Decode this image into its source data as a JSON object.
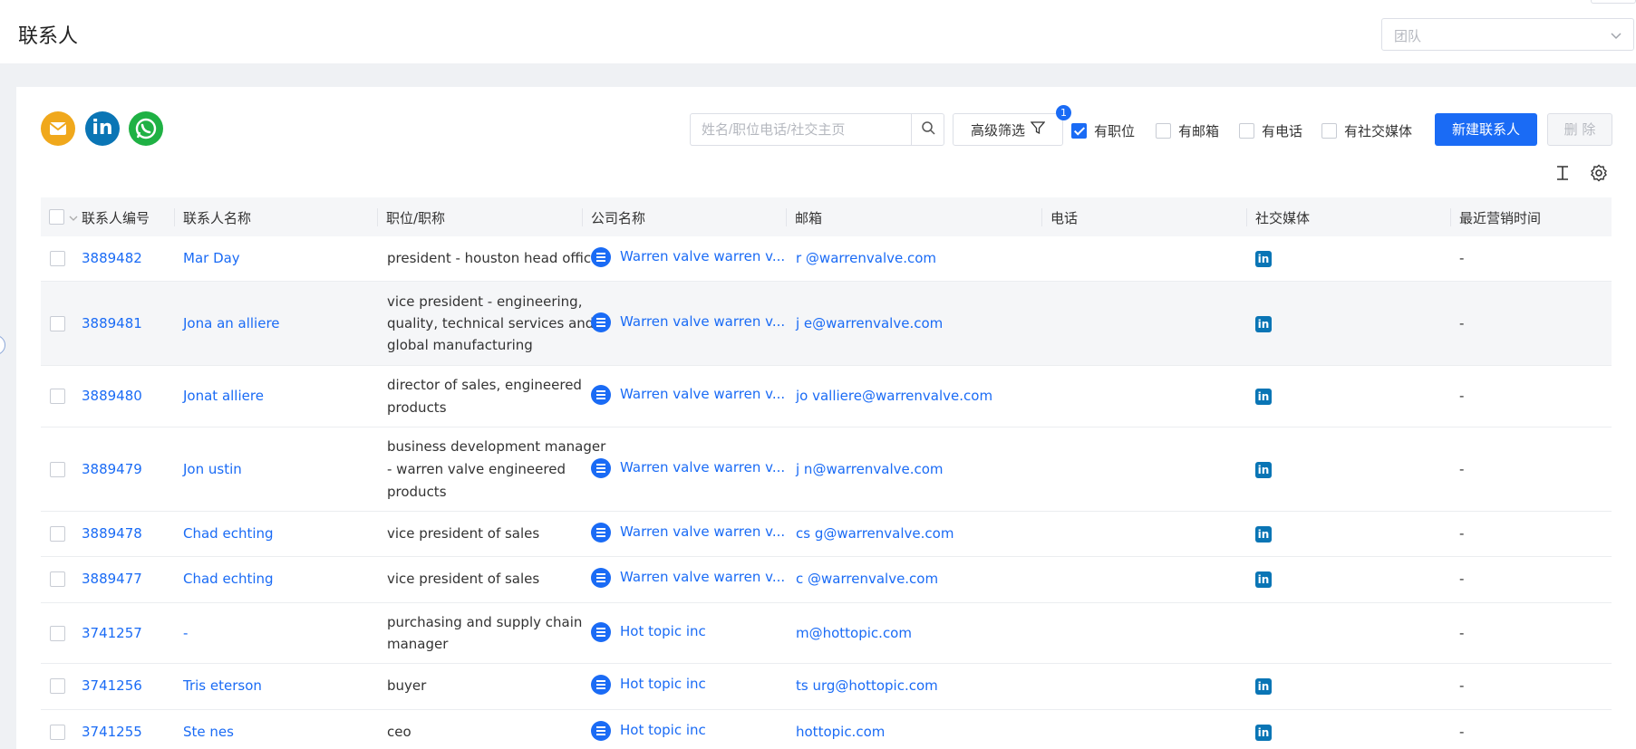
{
  "page_title": "联系人",
  "team_select": {
    "placeholder": "团队"
  },
  "search": {
    "placeholder": "姓名/职位电话/社交主页"
  },
  "advanced_filter": {
    "label": "高级筛选",
    "badge": "1"
  },
  "filters": [
    {
      "label": "有职位",
      "checked": true
    },
    {
      "label": "有邮箱",
      "checked": false
    },
    {
      "label": "有电话",
      "checked": false
    },
    {
      "label": "有社交媒体",
      "checked": false
    }
  ],
  "buttons": {
    "new_contact": "新建联系人",
    "delete": "删 除"
  },
  "columns": [
    "联系人编号",
    "联系人名称",
    "职位/职称",
    "公司名称",
    "邮箱",
    "电话",
    "社交媒体",
    "最近营销时间"
  ],
  "rows": [
    {
      "id": "3889482",
      "name": "Mar    Day",
      "title": [
        "president - houston head office"
      ],
      "company": "Warren valve warren v...",
      "email": "r      @warrenvalve.com",
      "phone": "",
      "linkedin": true,
      "last": "-"
    },
    {
      "id": "3889481",
      "name": "Jona    an    alliere",
      "title": [
        "vice president - engineering,",
        "quality, technical services and",
        "global manufacturing"
      ],
      "company": "Warren valve warren v...",
      "email": "j       e@warrenvalve.com",
      "phone": "",
      "linkedin": true,
      "last": "-"
    },
    {
      "id": "3889480",
      "name": "Jonat      alliere",
      "title": [
        "director of sales, engineered",
        "products"
      ],
      "company": "Warren valve warren v...",
      "email": "jo          valliere@warrenvalve.com",
      "phone": "",
      "linkedin": true,
      "last": "-"
    },
    {
      "id": "3889479",
      "name": "Jon    ustin",
      "title": [
        "business development manager",
        "- warren valve engineered",
        "products"
      ],
      "company": "Warren valve warren v...",
      "email": "j      n@warrenvalve.com",
      "phone": "",
      "linkedin": true,
      "last": "-"
    },
    {
      "id": "3889478",
      "name": "Chad     echting",
      "title": [
        "vice president of sales"
      ],
      "company": "Warren valve warren v...",
      "email": "cs         g@warrenvalve.com",
      "phone": "",
      "linkedin": true,
      "last": "-"
    },
    {
      "id": "3889477",
      "name": "Chad     echting",
      "title": [
        "vice president of sales"
      ],
      "company": "Warren valve warren v...",
      "email": "c      @warrenvalve.com",
      "phone": "",
      "linkedin": true,
      "last": "-"
    },
    {
      "id": "3741257",
      "name": "-",
      "title": [
        "purchasing and supply chain",
        "manager"
      ],
      "company": "Hot topic inc",
      "email": "        m@hottopic.com",
      "phone": "",
      "linkedin": false,
      "last": "-"
    },
    {
      "id": "3741256",
      "name": "Tris      eterson",
      "title": [
        "buyer"
      ],
      "company": "Hot topic inc",
      "email": "ts          urg@hottopic.com",
      "phone": "",
      "linkedin": true,
      "last": "-"
    },
    {
      "id": "3741255",
      "name": "Ste       nes",
      "title": [
        "ceo"
      ],
      "company": "Hot topic inc",
      "email": "          hottopic.com",
      "phone": "",
      "linkedin": true,
      "last": "-"
    }
  ],
  "colors": {
    "primary": "#1a6bf5",
    "linkedin": "#0a75b5",
    "mail": "#f0a81c",
    "whatsapp": "#1fb144"
  }
}
